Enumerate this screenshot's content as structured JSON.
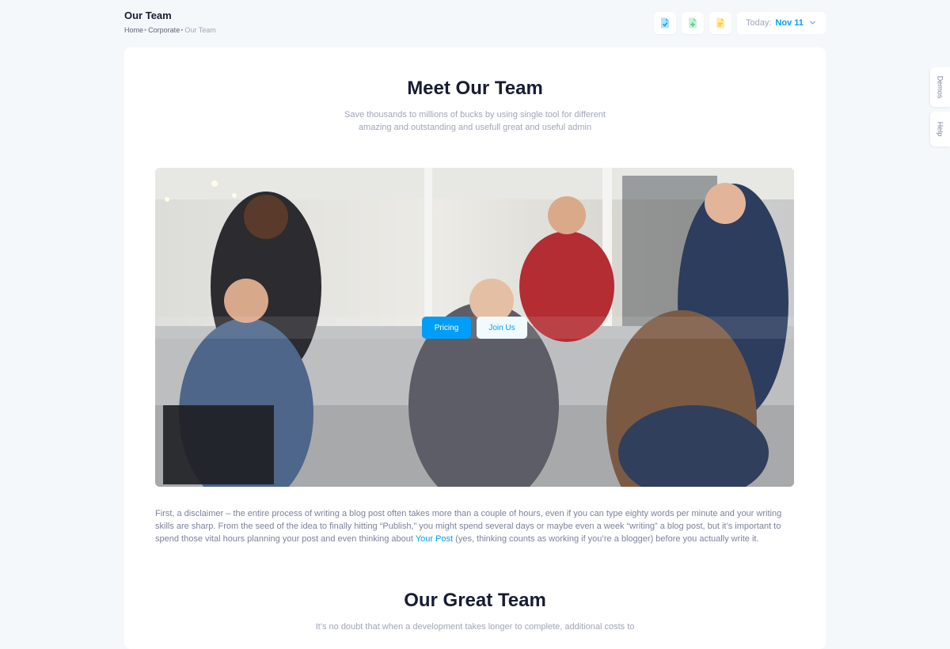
{
  "header": {
    "title": "Our Team",
    "breadcrumb": [
      "Home",
      "Corporate",
      "Our Team"
    ]
  },
  "toolbar": {
    "buttons": [
      {
        "icon": "file-check-icon",
        "color": "#009ef7"
      },
      {
        "icon": "file-plus-icon",
        "color": "#50cd89"
      },
      {
        "icon": "file-text-icon",
        "color": "#ffc700"
      }
    ],
    "date_label": "Today:",
    "date_value": "Nov 11"
  },
  "side_tabs": [
    "Demos",
    "Help"
  ],
  "hero": {
    "title": "Meet Our Team",
    "subtitle_line1": "Save thousands to millions of bucks by using single tool for different",
    "subtitle_line2": "amazing and outstanding and usefull great and useful admin",
    "pricing_label": "Pricing",
    "join_label": "Join Us"
  },
  "article": {
    "text_before": "First, a disclaimer – the entire process of writing a blog post often takes more than a couple of hours, even if you can type eighty words per minute and your writing skills are sharp. From the seed of the idea to finally hitting “Publish,” you might spend several days or maybe even a week “writing” a blog post, but it’s important to spend those vital hours planning your post and even thinking about ",
    "link_text": "Your Post",
    "text_after": " (yes, thinking counts as working if you’re a blogger) before you actually write it."
  },
  "section2": {
    "title": "Our Great Team",
    "subtitle": "It’s no doubt that when a development takes longer to complete, additional costs to"
  },
  "colors": {
    "accent": "#009ef7",
    "background": "#f5f8fa",
    "card": "#ffffff",
    "heading": "#181c32",
    "muted": "#a1a5b7"
  }
}
